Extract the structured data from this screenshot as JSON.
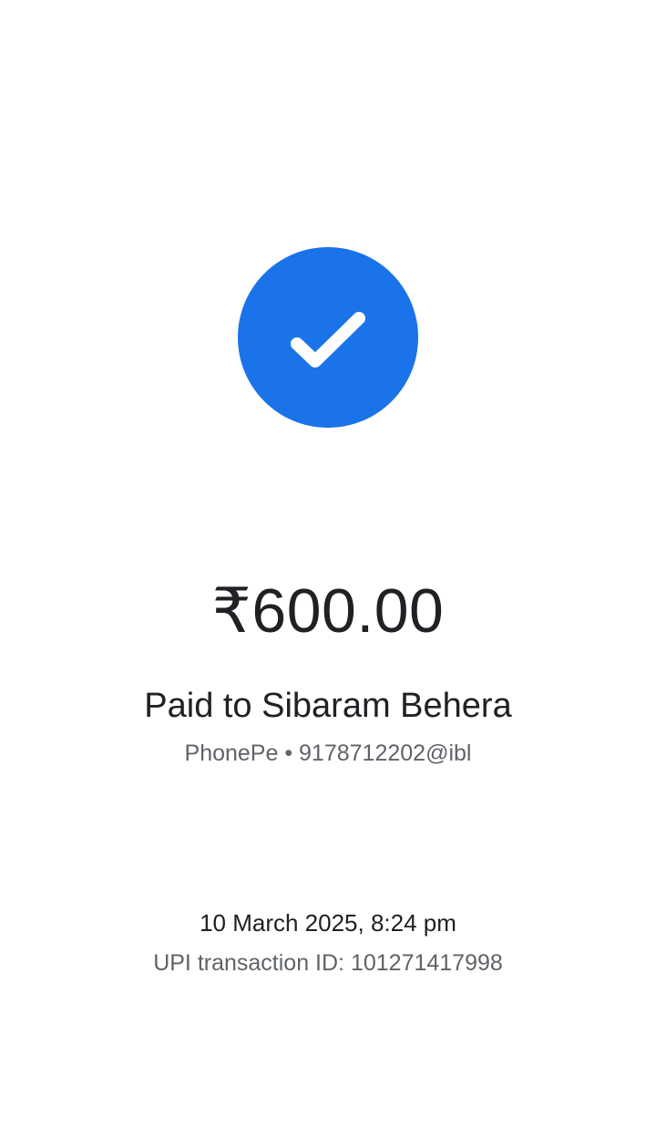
{
  "colors": {
    "accent": "#1a73e8",
    "text_primary": "#202124",
    "text_secondary": "#5f6368",
    "background": "#ffffff"
  },
  "status": {
    "icon": "check-icon"
  },
  "payment": {
    "amount": "₹600.00",
    "payee_line": "Paid to Sibaram Behera",
    "payee_details": "PhonePe • 9178712202@ibl"
  },
  "transaction": {
    "datetime": "10 March 2025, 8:24 pm",
    "upi_id": "UPI transaction ID: 101271417998"
  }
}
